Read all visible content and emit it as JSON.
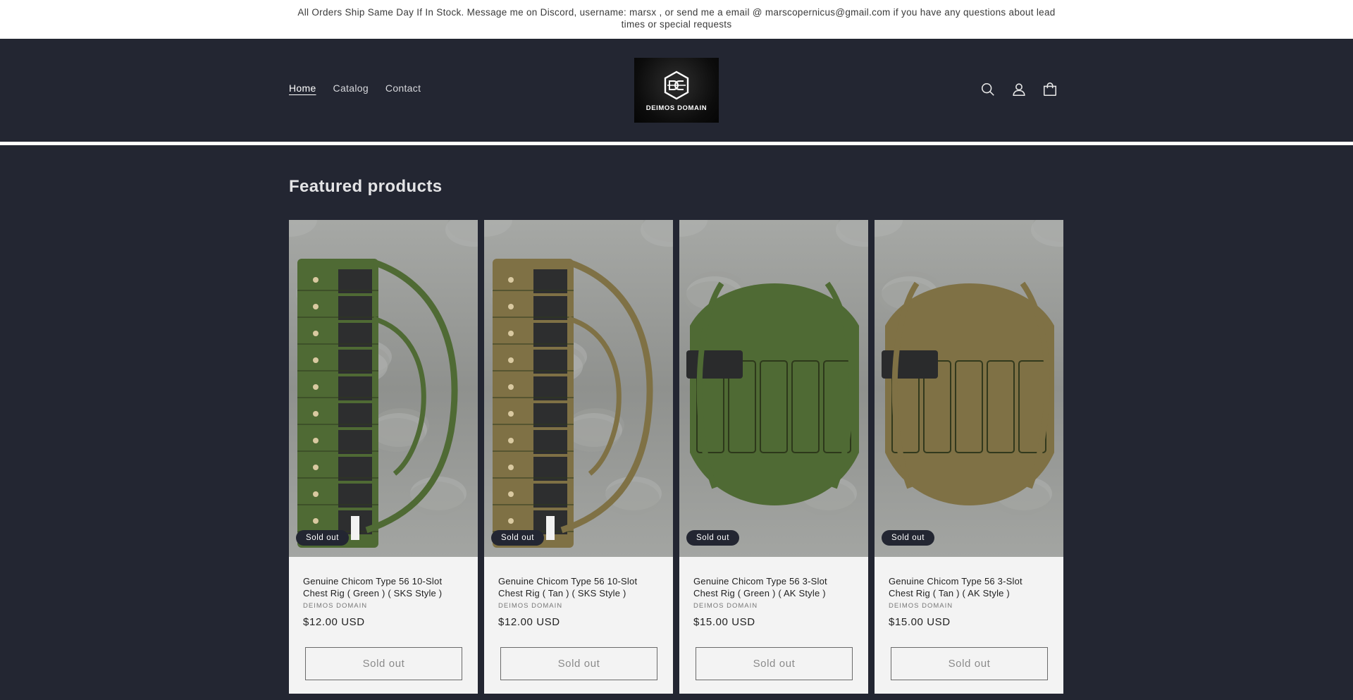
{
  "announcement": {
    "text": "All Orders Ship Same Day If In Stock. Message me on Discord, username: marsx , or send me a email @ marscopernicus@gmail.com if you have any questions about lead times or special requests"
  },
  "header": {
    "nav": [
      {
        "label": "Home",
        "active": true
      },
      {
        "label": "Catalog",
        "active": false
      },
      {
        "label": "Contact",
        "active": false
      }
    ],
    "logo": {
      "text": "DEIMOS DOMAIN",
      "mark": "DD"
    },
    "icons": [
      "search-icon",
      "account-icon",
      "cart-icon"
    ]
  },
  "featured": {
    "title": "Featured products",
    "products": [
      {
        "title": "Genuine Chicom Type 56 10-Slot Chest Rig ( Green ) ( SKS Style )",
        "vendor": "DEIMOS DOMAIN",
        "price": "$12.00 USD",
        "badge": "Sold out",
        "button": "Sold out",
        "color": "green"
      },
      {
        "title": "Genuine Chicom Type 56 10-Slot Chest Rig ( Tan ) ( SKS Style )",
        "vendor": "DEIMOS DOMAIN",
        "price": "$12.00 USD",
        "badge": "Sold out",
        "button": "Sold out",
        "color": "tan"
      },
      {
        "title": "Genuine Chicom Type 56 3-Slot Chest Rig ( Green ) ( AK Style )",
        "vendor": "DEIMOS DOMAIN",
        "price": "$15.00 USD",
        "badge": "Sold out",
        "button": "Sold out",
        "color": "green"
      },
      {
        "title": "Genuine Chicom Type 56 3-Slot Chest Rig ( Tan ) ( AK Style )",
        "vendor": "DEIMOS DOMAIN",
        "price": "$15.00 USD",
        "badge": "Sold out",
        "button": "Sold out",
        "color": "tan"
      }
    ]
  },
  "colors": {
    "background": "#232632",
    "card": "#f3f3f3",
    "badge": "#232632",
    "rig_green": "#4f6a34",
    "rig_tan": "#7f7145"
  }
}
